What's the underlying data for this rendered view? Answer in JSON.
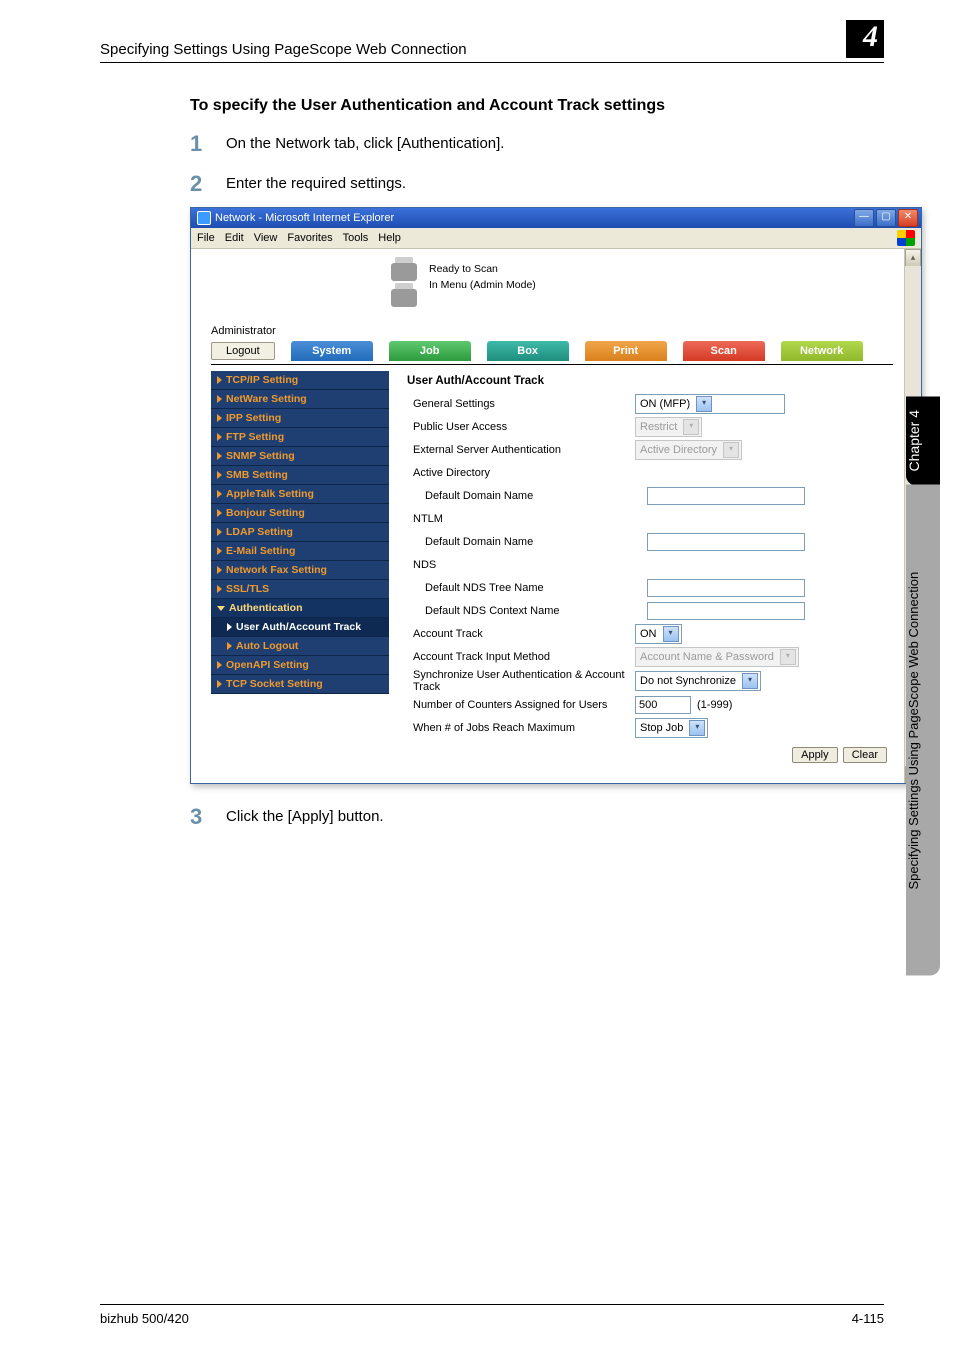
{
  "header": {
    "title": "Specifying Settings Using PageScope Web Connection",
    "badge": "4"
  },
  "subtitle": "To specify the User Authentication and Account Track settings",
  "steps": {
    "s1": {
      "num": "1",
      "text": "On the Network tab, click [Authentication]."
    },
    "s2": {
      "num": "2",
      "text": "Enter the required settings."
    },
    "s3": {
      "num": "3",
      "text": "Click the [Apply] button."
    }
  },
  "browser": {
    "title": "Network - Microsoft Internet Explorer",
    "menus": [
      "File",
      "Edit",
      "View",
      "Favorites",
      "Tools",
      "Help"
    ],
    "status": {
      "l1": "Ready to Scan",
      "l2": "In Menu (Admin Mode)"
    },
    "admin_label": "Administrator",
    "logout": "Logout",
    "tabs": [
      "System",
      "Job",
      "Box",
      "Print",
      "Scan",
      "Network"
    ],
    "sidebar": [
      {
        "label": "TCP/IP Setting",
        "marker": "tri"
      },
      {
        "label": "NetWare Setting",
        "marker": "tri"
      },
      {
        "label": "IPP Setting",
        "marker": "tri"
      },
      {
        "label": "FTP Setting",
        "marker": "tri"
      },
      {
        "label": "SNMP Setting",
        "marker": "tri"
      },
      {
        "label": "SMB Setting",
        "marker": "tri"
      },
      {
        "label": "AppleTalk Setting",
        "marker": "tri"
      },
      {
        "label": "Bonjour Setting",
        "marker": "tri"
      },
      {
        "label": "LDAP Setting",
        "marker": "tri"
      },
      {
        "label": "E-Mail Setting",
        "marker": "tri"
      },
      {
        "label": "Network Fax Setting",
        "marker": "tri"
      },
      {
        "label": "SSL/TLS",
        "marker": "tri"
      },
      {
        "label": "Authentication",
        "marker": "down",
        "expanded": true
      },
      {
        "label": "User Auth/Account Track",
        "marker": "tri",
        "selected": true,
        "sub": true
      },
      {
        "label": "Auto Logout",
        "marker": "tri",
        "sub": true
      },
      {
        "label": "OpenAPI Setting",
        "marker": "tri"
      },
      {
        "label": "TCP Socket Setting",
        "marker": "tri"
      }
    ],
    "panel": {
      "title": "User Auth/Account Track",
      "general_settings": "General Settings",
      "general_settings_value": "ON (MFP)",
      "public_user_access": "Public User Access",
      "public_user_access_value": "Restrict",
      "ext_server_auth": "External Server Authentication",
      "ext_server_auth_value": "Active Directory",
      "active_directory": "Active Directory",
      "default_domain_name": "Default Domain Name",
      "ntlm": "NTLM",
      "nds": "NDS",
      "default_nds_tree": "Default NDS Tree Name",
      "default_nds_context": "Default NDS Context Name",
      "account_track": "Account Track",
      "account_track_value": "ON",
      "account_track_input": "Account Track Input Method",
      "account_track_input_value": "Account Name & Password",
      "sync_auth": "Synchronize User Authentication & Account Track",
      "sync_auth_value": "Do not Synchronize",
      "counters": "Number of Counters Assigned for Users",
      "counters_value": "500",
      "counters_range": "(1-999)",
      "max_jobs": "When # of Jobs Reach Maximum",
      "max_jobs_value": "Stop Job",
      "apply": "Apply",
      "clear": "Clear"
    }
  },
  "sidetab": {
    "top": "Chapter 4",
    "bottom": "Specifying Settings Using PageScope Web Connection"
  },
  "footer": {
    "left": "bizhub 500/420",
    "right": "4-115"
  }
}
